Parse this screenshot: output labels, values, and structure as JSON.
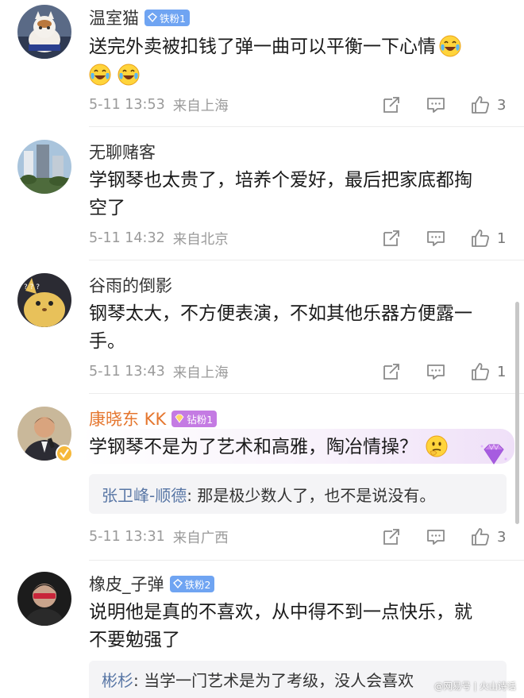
{
  "comments": [
    {
      "username": "温室猫",
      "badge": "铁粉1",
      "text": "送完外卖被扣钱了弹一曲可以平衡一下心情",
      "time": "5-11 13:53",
      "location": "来自上海",
      "likes": "3"
    },
    {
      "username": "无聊赌客",
      "text_line1": "学钢琴也太贵了，培养个爱好，最后把家底都掏",
      "text_line2": "空了",
      "time": "5-11 14:32",
      "location": "来自北京",
      "likes": "1"
    },
    {
      "username": "谷雨的倒影",
      "text_line1": "钢琴太大，不方便表演，不如其他乐器方便露一",
      "text_line2": "手。",
      "time": "5-11 13:43",
      "location": "来自上海",
      "likes": "1"
    },
    {
      "username": "康晓东 KK",
      "badge": "钻粉1",
      "text": "学钢琴不是为了艺术和高雅，陶冶情操？",
      "reply_name": "张卫峰-顺德",
      "reply_text": ": 那是极少数人了，也不是说没有。",
      "time": "5-11 13:31",
      "location": "来自广西",
      "likes": "3"
    },
    {
      "username": "橡皮_子弹",
      "badge": "铁粉2",
      "text_line1": "说明他是真的不喜欢，从中得不到一点快乐，就",
      "text_line2": "不要勉强了",
      "reply_name": "彬杉",
      "reply_text": ": 当学一门艺术是为了考级，没人会喜欢"
    }
  ],
  "watermark": "@网易号 | 火山诗话",
  "colors": {
    "vip_name": "#e5762e",
    "reply_name": "#5876a5",
    "iron_badge": "#6fa4f2",
    "diamond_badge": "#c47be3",
    "meta_text": "#9a9a9a"
  },
  "icons": [
    "repost-icon",
    "comment-icon",
    "thumbs-up-icon",
    "laughing-crying-emoji-icon",
    "thinking-emoji-icon",
    "diamond-gem-icon",
    "verified-icon"
  ]
}
